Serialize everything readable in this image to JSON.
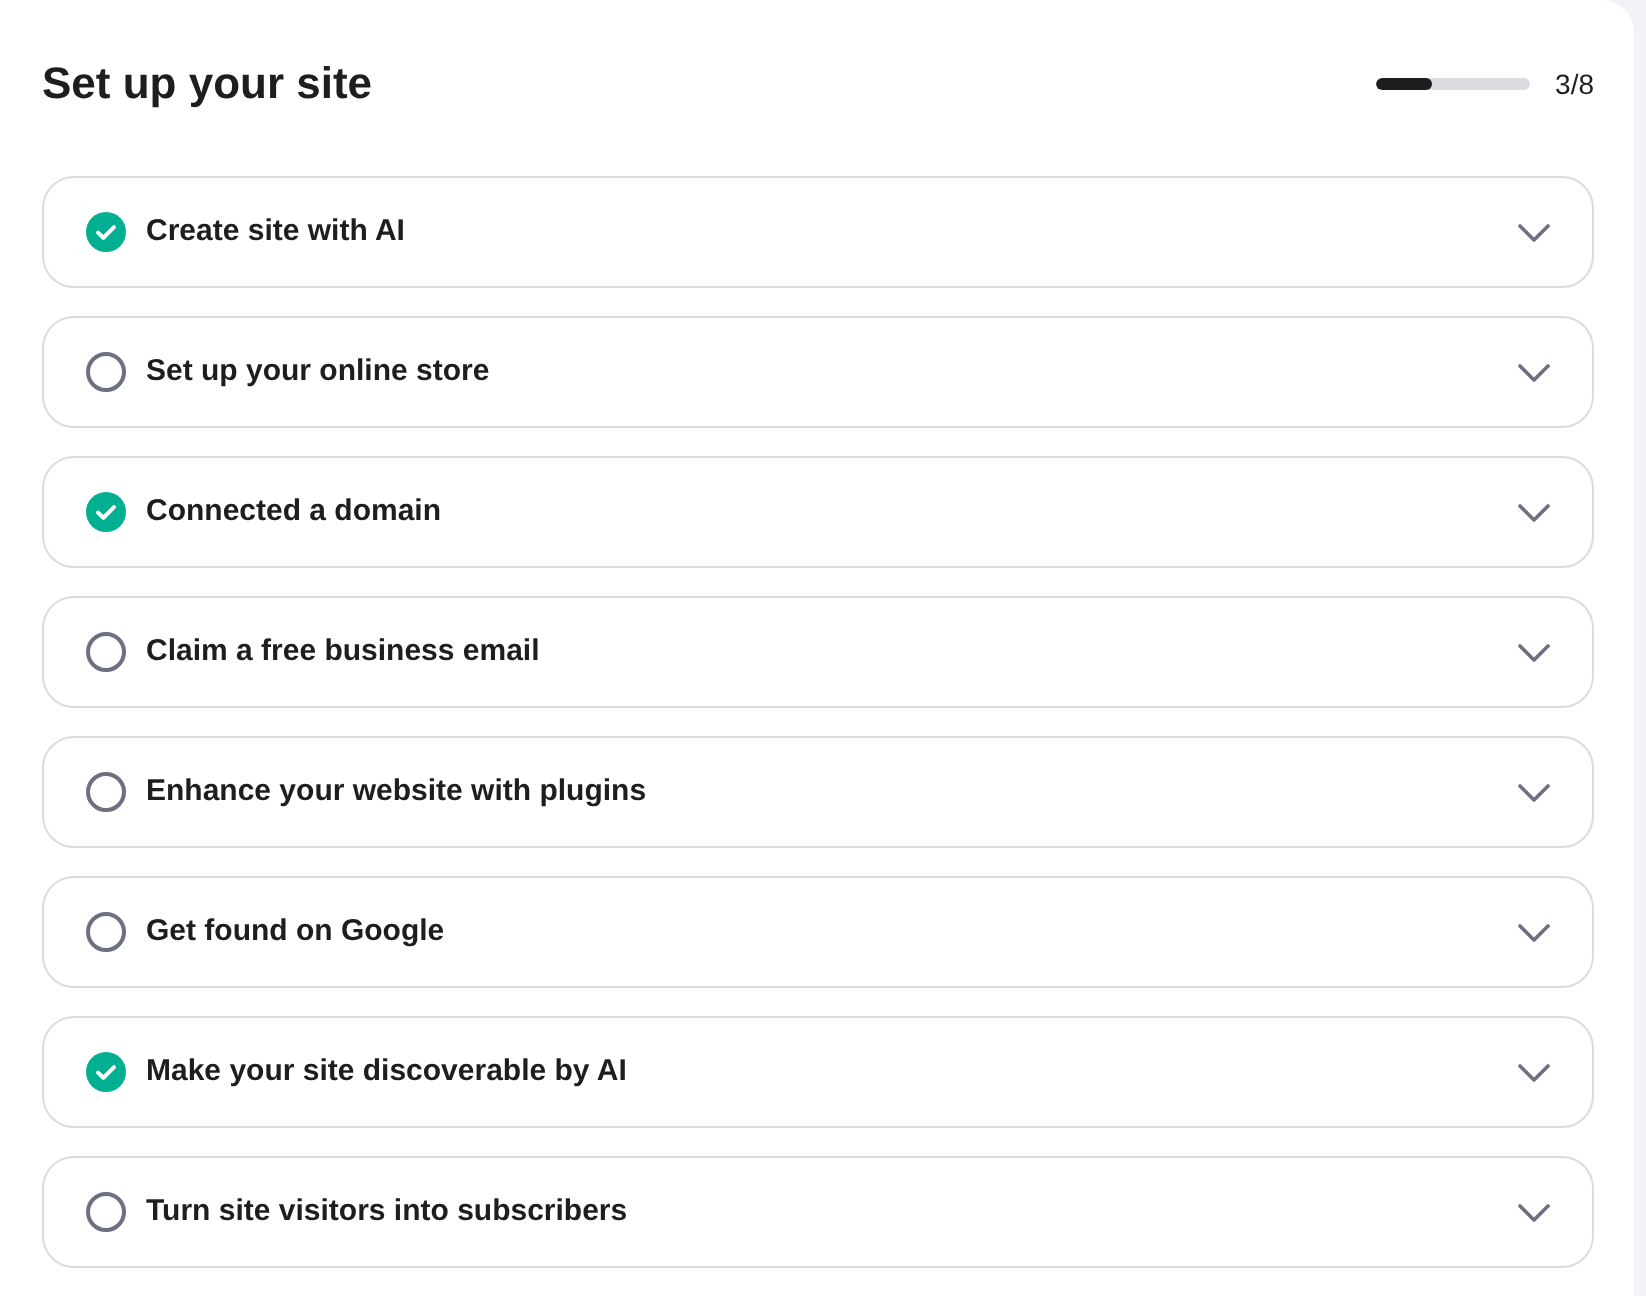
{
  "title": "Set up your site",
  "progress": {
    "level": 0.375,
    "label": "3/8"
  },
  "steps": [
    {
      "label": "Create site with AI",
      "checked": true,
      "expanded": false
    },
    {
      "label": "Set up your online store",
      "checked": false,
      "expanded": false
    },
    {
      "label": "Connected a domain",
      "checked": true,
      "expanded": false
    },
    {
      "label": "Claim a free business email",
      "checked": false,
      "expanded": false
    },
    {
      "label": "Enhance your website with plugins",
      "checked": false,
      "expanded": false
    },
    {
      "label": "Get found on Google",
      "checked": false,
      "expanded": false
    },
    {
      "label": "Make your site discoverable by AI",
      "checked": true,
      "expanded": false
    },
    {
      "label": "Turn site visitors into subscribers",
      "checked": false,
      "expanded": false
    }
  ]
}
